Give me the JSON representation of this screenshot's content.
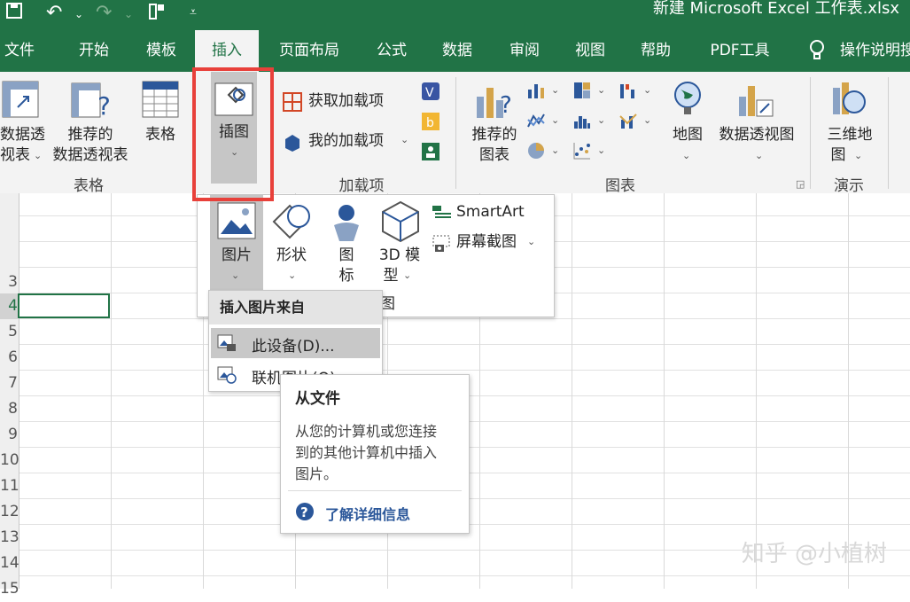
{
  "title_bar": {
    "title": "新建 Microsoft Excel 工作表.xlsx"
  },
  "tabs": [
    {
      "label": "文件"
    },
    {
      "label": "开始"
    },
    {
      "label": "模板"
    },
    {
      "label": "插入"
    },
    {
      "label": "页面布局"
    },
    {
      "label": "公式"
    },
    {
      "label": "数据"
    },
    {
      "label": "审阅"
    },
    {
      "label": "视图"
    },
    {
      "label": "帮助"
    },
    {
      "label": "PDF工具"
    },
    {
      "label": "操作说明搜"
    }
  ],
  "active_tab": "插入",
  "ribbon": {
    "pivot_table": {
      "line1": "数据透",
      "line2": "视表"
    },
    "recommended_pivot": {
      "line1": "推荐的",
      "line2": "数据透视表"
    },
    "table": {
      "label": "表格"
    },
    "illustrations": {
      "label": "插图"
    },
    "get_addins": {
      "label": "获取加载项"
    },
    "my_addins": {
      "label": "我的加载项"
    },
    "recommended_charts": {
      "line1": "推荐的",
      "line2": "图表"
    },
    "map": {
      "label": "地图"
    },
    "pivot_chart": {
      "label": "数据透视图"
    },
    "map3d": {
      "line1": "三维地",
      "line2": "图"
    },
    "groups": {
      "tables": "表格",
      "addins": "加载项",
      "charts": "图表",
      "tours": "演示"
    }
  },
  "illustrations_menu": {
    "pictures": "图片",
    "shapes": "形状",
    "icons_line1": "图",
    "icons_line2": "标",
    "models3d_line1": "3D 模",
    "models3d_line2": "型",
    "smartart": "SmartArt",
    "screenshot": "屏幕截图",
    "group_label_partial": "图"
  },
  "pictures_submenu": {
    "header": "插入图片来自",
    "this_device": "此设备(D)...",
    "online_pictures": "联机图片(O)..."
  },
  "tooltip": {
    "title": "从文件",
    "body_line1": "从您的计算机或您连接",
    "body_line2": "到的其他计算机中插入",
    "body_line3": "图片。",
    "link": "了解详细信息"
  },
  "row_headers": [
    "",
    "",
    "",
    "3",
    "4",
    "5",
    "6",
    "7",
    "8",
    "9",
    "10",
    "11",
    "12",
    "13",
    "14",
    "15"
  ],
  "watermark": "知乎 @小植树",
  "colors": {
    "excel_green": "#217346",
    "highlight_red": "#e8403a",
    "link_blue": "#2b579a"
  }
}
